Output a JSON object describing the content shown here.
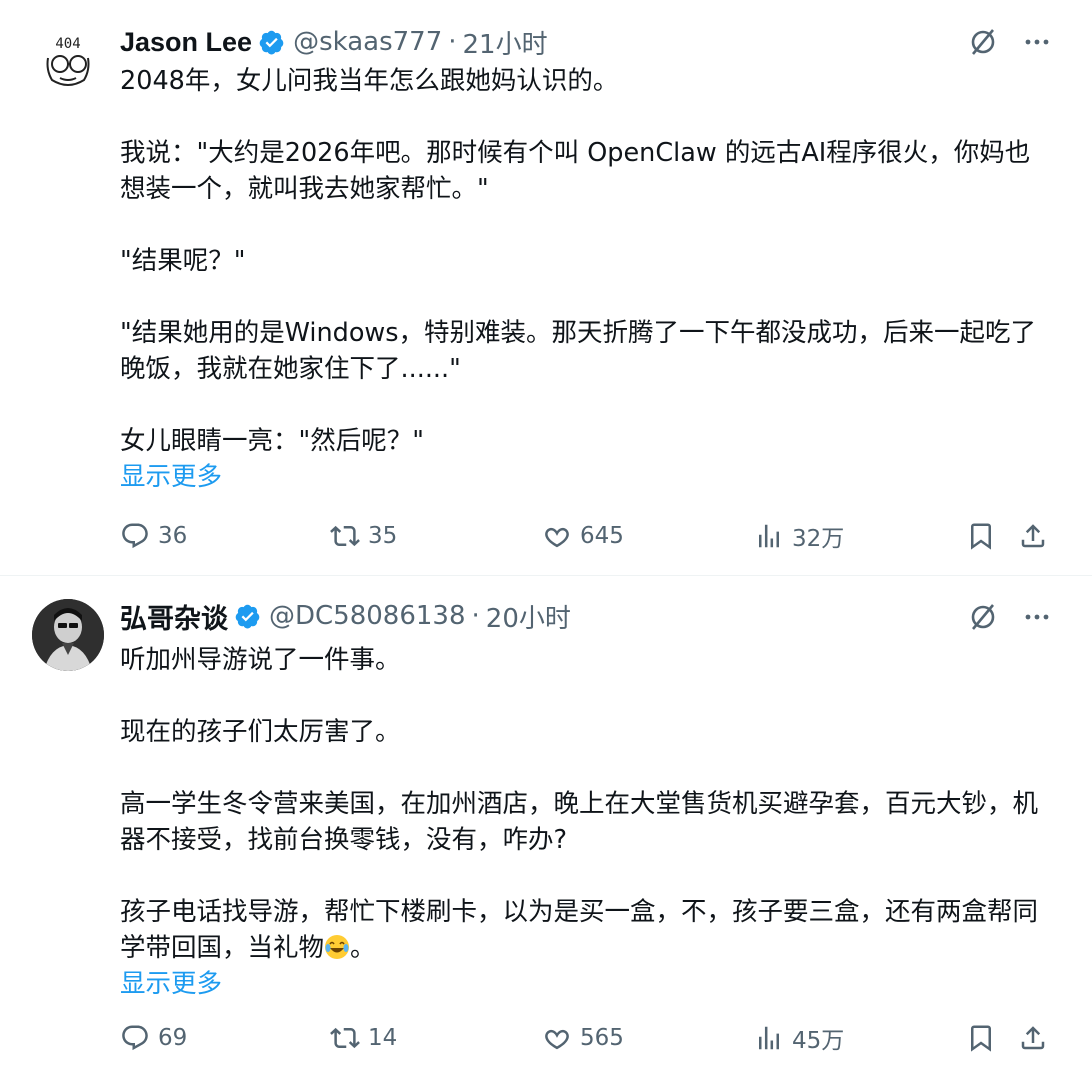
{
  "tweets": [
    {
      "author": {
        "name": "Jason Lee",
        "handle": "@skaas777",
        "verified": true
      },
      "separator": "·",
      "time": "21小时",
      "text": [
        "2048年，女儿问我当年怎么跟她妈认识的。",
        "我说：\"大约是2026年吧。那时候有个叫 OpenClaw 的远古AI程序很火，你妈也想装一个，就叫我去她家帮忙。\"",
        "\"结果呢？\"",
        "\"结果她用的是Windows，特别难装。那天折腾了一下午都没成功，后来一起吃了晚饭，我就在她家住下了......\"",
        "女儿眼睛一亮：\"然后呢？\""
      ],
      "show_more": "显示更多",
      "stats": {
        "replies": "36",
        "reposts": "35",
        "likes": "645",
        "views": "32万"
      }
    },
    {
      "author": {
        "name": "弘哥杂谈",
        "handle": "@DC58086138",
        "verified": true
      },
      "separator": "·",
      "time": "20小时",
      "text": [
        "听加州导游说了一件事。",
        "现在的孩子们太厉害了。",
        "高一学生冬令营来美国，在加州酒店，晚上在大堂售货机买避孕套，百元大钞，机器不接受，找前台换零钱，没有，咋办?",
        "孩子电话找导游，帮忙下楼刷卡，以为是买一盒，不，孩子要三盒，还有两盒帮同学带回国，当礼物",
        "。"
      ],
      "show_more": "显示更多",
      "stats": {
        "replies": "69",
        "reposts": "14",
        "likes": "565",
        "views": "45万"
      }
    }
  ],
  "icons": [
    "verified-badge-icon",
    "grok-icon",
    "more-icon",
    "reply-icon",
    "repost-icon",
    "like-icon",
    "views-icon",
    "bookmark-icon",
    "share-icon",
    "laughing-emoji-icon"
  ],
  "colors": {
    "accent": "#1d9bf0",
    "text": "#0f1419",
    "muted": "#536471"
  }
}
